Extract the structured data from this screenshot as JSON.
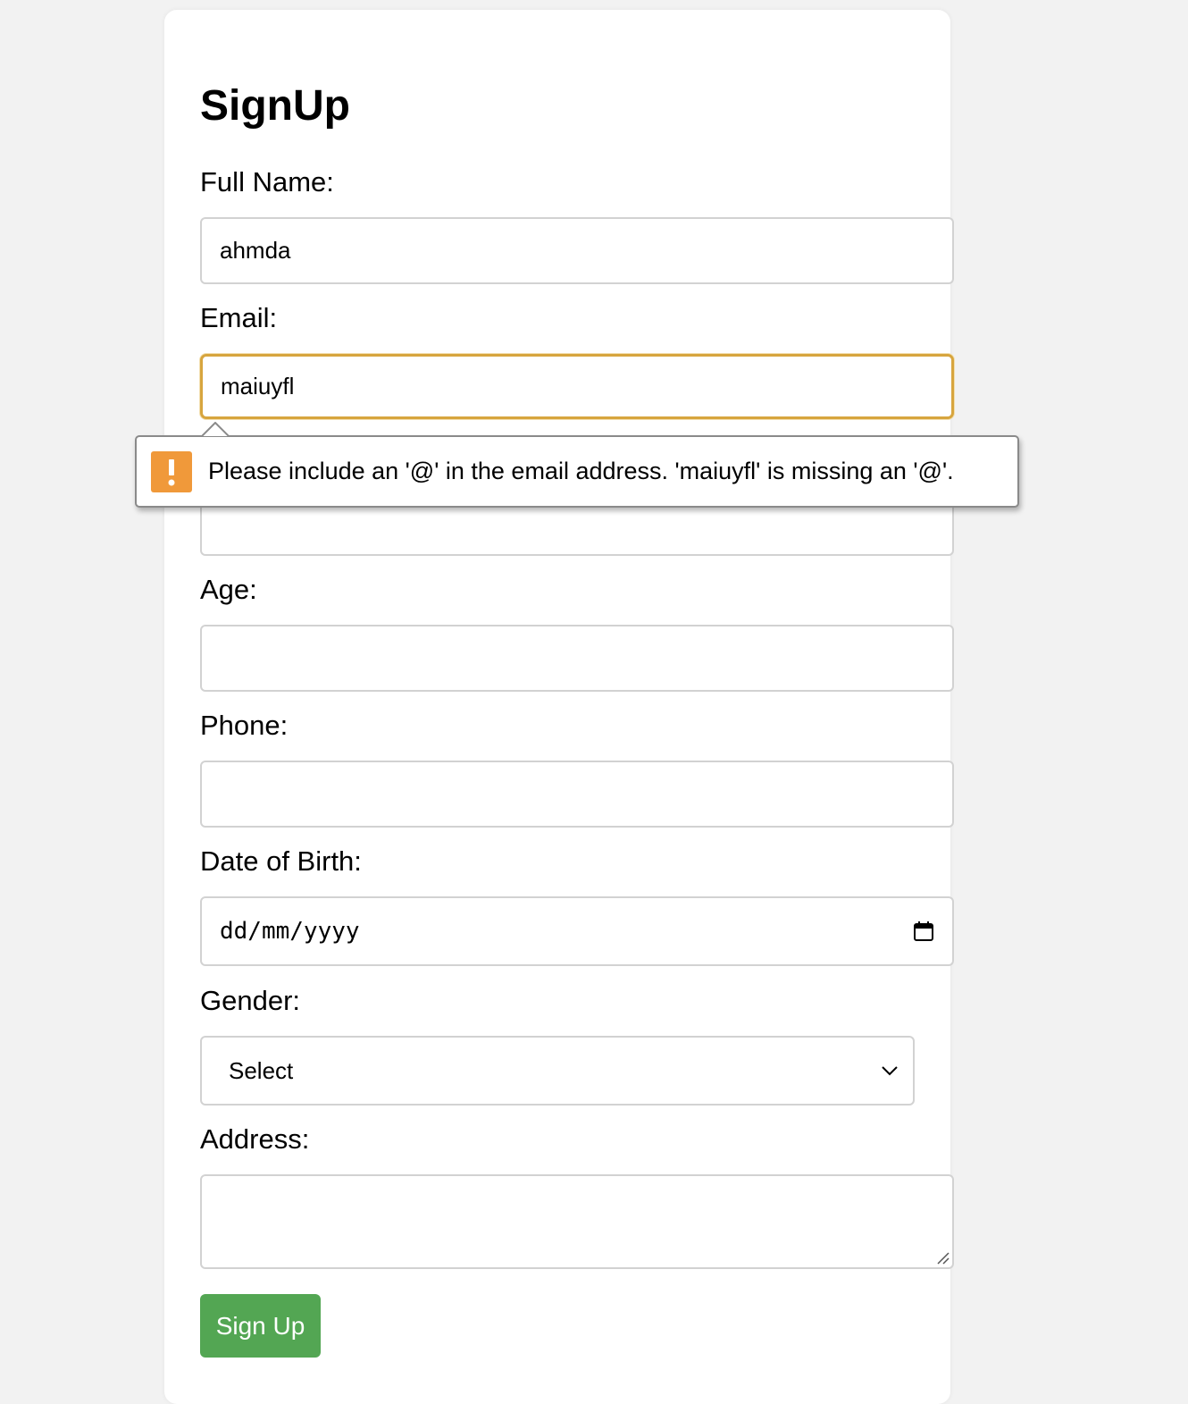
{
  "form": {
    "title": "SignUp",
    "full_name_label": "Full Name:",
    "full_name_value": "ahmda",
    "email_label": "Email:",
    "email_value": "maiuyfl",
    "password_value": "",
    "age_label": "Age:",
    "age_value": "",
    "phone_label": "Phone:",
    "phone_value": "",
    "dob_label": "Date of Birth:",
    "dob_placeholder": "dd/mm/yyyy",
    "gender_label": "Gender:",
    "gender_selected": "Select",
    "address_label": "Address:",
    "address_value": "",
    "submit_label": "Sign Up"
  },
  "validation": {
    "message": "Please include an '@' in the email address. 'maiuyfl' is missing an '@'.",
    "icon": "exclamation-icon",
    "icon_color": "#f0993a"
  },
  "colors": {
    "background": "#f2f2f2",
    "card": "#ffffff",
    "button": "#53a653",
    "focus_border": "#d7a53e",
    "field_border": "#d2d2d2"
  }
}
